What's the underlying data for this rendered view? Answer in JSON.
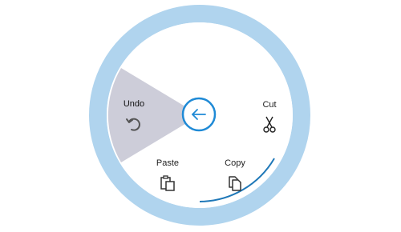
{
  "menu": {
    "back_icon": "arrow-left-icon",
    "accent_color": "#1f8ad6",
    "ring_color": "#b0d4ee",
    "selected_wedge_color": "#cdcdd9",
    "items": [
      {
        "id": "undo",
        "label": "Undo",
        "icon": "undo-icon",
        "selected": true
      },
      {
        "id": "cut",
        "label": "Cut",
        "icon": "scissors-icon",
        "selected": false
      },
      {
        "id": "paste",
        "label": "Paste",
        "icon": "paste-icon",
        "selected": false
      },
      {
        "id": "copy",
        "label": "Copy",
        "icon": "copy-icon",
        "selected": false
      }
    ]
  }
}
